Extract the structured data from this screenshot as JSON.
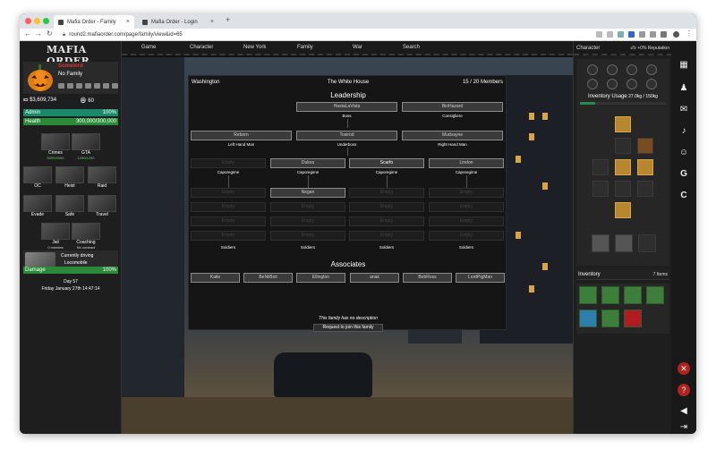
{
  "browser": {
    "tabs": [
      {
        "label": "Mafia Order - Family",
        "active": true
      },
      {
        "label": "Mafia Order - Login",
        "active": false
      }
    ],
    "url": "round2.mafiaorder.com/page/family/view&id=65"
  },
  "left": {
    "logo": "MAFIA ORDER",
    "player_name": "Somelord",
    "family": "No Family",
    "cash": "$3,609,734",
    "points": "60",
    "admin": {
      "label": "Admin",
      "value": "100%",
      "fraction": 1.0,
      "color": "#1b8a6b"
    },
    "health": {
      "label": "Health",
      "value": "300,000/300,000",
      "fraction": 1.0,
      "color": "#2a8a3a"
    },
    "tiles": [
      {
        "label": "Crimes",
        "sub": "5000/5000"
      },
      {
        "label": "GTA",
        "sub": "1250/1250"
      },
      {
        "label": "OC",
        "sub": ""
      },
      {
        "label": "Heist",
        "sub": ""
      },
      {
        "label": "Raid",
        "sub": ""
      },
      {
        "label": "Evade",
        "sub": ""
      },
      {
        "label": "Safe",
        "sub": ""
      },
      {
        "label": "Travel",
        "sub": ""
      },
      {
        "label": "Jail",
        "sub": "0 minutes"
      },
      {
        "label": "Coaching",
        "sub": "No contract"
      }
    ],
    "driving_label": "Currently driving",
    "car": "Locomobile",
    "damage": {
      "label": "Damage",
      "value": "100%",
      "fraction": 1.0,
      "color": "#2a8a3a"
    },
    "day": "Day 57",
    "date": "Friday January 27th 14:47:14"
  },
  "topnav": [
    "Game",
    "Character",
    "New York",
    "Family",
    "War",
    "Search"
  ],
  "family": {
    "location": "Washington",
    "hq": "The White House",
    "members": "15 / 20 Members",
    "leadership_title": "Leadership",
    "boss": {
      "name": "HastaLaVista",
      "role": "Boss"
    },
    "consigliere": {
      "name": "BioHazard",
      "role": "Consigliere"
    },
    "left_hand": {
      "name": "Reborn",
      "role": "Left Hand Man"
    },
    "underboss": {
      "name": "Tosirod",
      "role": "Underboss"
    },
    "right_hand": {
      "name": "Mudvayne",
      "role": "Right Hand Man"
    },
    "capos": [
      {
        "name": "Empty",
        "role": "Caporegime"
      },
      {
        "name": "Dukes",
        "role": "Caporegime"
      },
      {
        "name": "Scarfo",
        "role": "Caporegime"
      },
      {
        "name": "Lindon",
        "role": "Caporegime"
      }
    ],
    "soldier_cols": [
      [
        "Empty",
        "Empty",
        "Empty",
        "Empty"
      ],
      [
        "Negan",
        "Empty",
        "Empty",
        "Empty"
      ],
      [
        "Empty",
        "Empty",
        "Empty",
        "Empty"
      ],
      [
        "Empty",
        "Empty",
        "Empty",
        "Empty"
      ]
    ],
    "soldiers_label": "Soldiers",
    "associates_title": "Associates",
    "associates": [
      "Katie",
      "BeNiiBoii",
      "Ellington",
      "anak",
      "BobRoss",
      "LordPigMan"
    ],
    "description": "This family has no description",
    "join_button": "Request to join this family"
  },
  "right": {
    "title": "Character",
    "reputation": "+0% Reputation",
    "inventory_usage_label": "Inventory Usage",
    "inventory_usage_value": "27.0kg / 150kg",
    "usage_fraction": 0.18,
    "inventory_title": "Inventory",
    "inventory_count": "7 Items",
    "inventory_items": [
      "cash-bundle-icon",
      "rifle-icon",
      "rifle-icon",
      "coffee-icon",
      "pistol-icon",
      "coffee-icon",
      "gift-box-icon"
    ]
  },
  "strip_icons": [
    "map-icon",
    "family-icon",
    "mail-icon",
    "bell-icon",
    "friends-icon",
    "g-icon",
    "c-icon",
    "tools-icon",
    "help-icon",
    "sound-icon",
    "logout-icon"
  ]
}
